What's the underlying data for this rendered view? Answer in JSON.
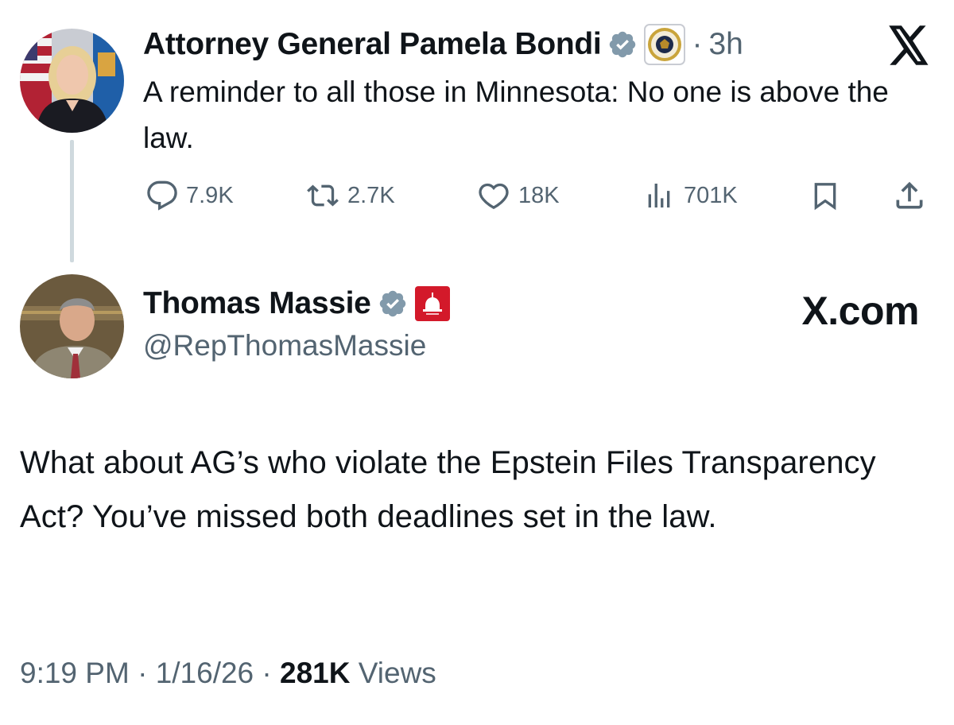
{
  "original_post": {
    "author_name": "Attorney General Pamela Bondi",
    "separator": "·",
    "time": "3h",
    "text": "A reminder to all those in Minnesota:  No one is above the law.",
    "actions": {
      "replies": "7.9K",
      "reposts": "2.7K",
      "likes": "18K",
      "views": "701K"
    },
    "icons": [
      "verified-badge-icon",
      "doj-seal-icon",
      "x-logo-icon",
      "reply-icon",
      "repost-icon",
      "like-icon",
      "views-icon",
      "bookmark-icon",
      "share-icon"
    ]
  },
  "quote_post": {
    "author_name": "Thomas Massie",
    "handle": "@RepThomasMassie",
    "brand": "X.com",
    "text": "What about AG’s who violate the Epstein Files Transparency Act? You’ve missed both deadlines set in the law.",
    "footer": {
      "time": "9:19 PM",
      "sep1": " · ",
      "date": "1/16/26",
      "sep2": " · ",
      "views_count": "281K",
      "views_label": " Views"
    },
    "icons": [
      "verified-badge-icon",
      "house-gop-badge-icon"
    ]
  },
  "colors": {
    "text": "#0f1419",
    "muted": "#536471",
    "verified": "#829aab",
    "gop_red": "#d3192a",
    "thread_line": "#cfd9de"
  }
}
